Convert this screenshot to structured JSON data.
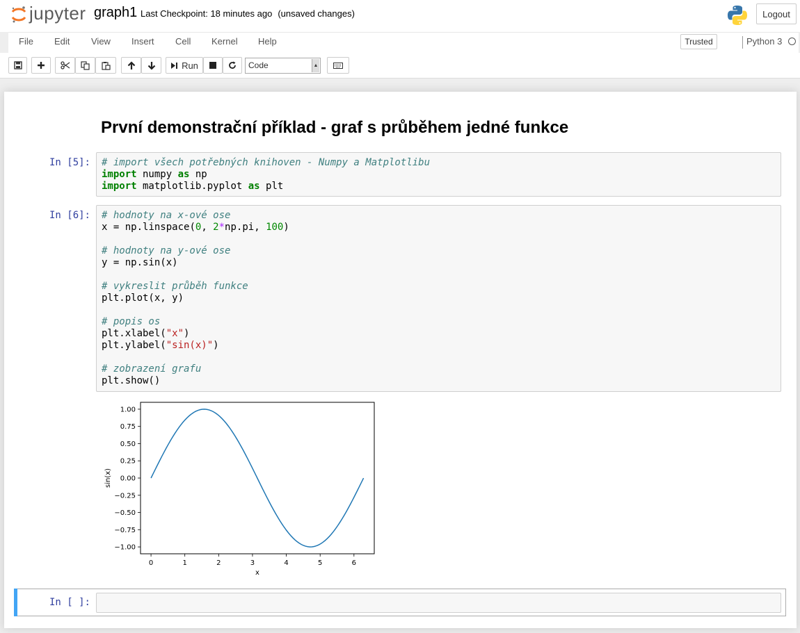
{
  "header": {
    "logo_text": "jupyter",
    "notebook_name": "graph1",
    "checkpoint": "Last Checkpoint: 18 minutes ago",
    "unsaved": "(unsaved changes)",
    "logout_label": "Logout"
  },
  "menubar": {
    "items": [
      "File",
      "Edit",
      "View",
      "Insert",
      "Cell",
      "Kernel",
      "Help"
    ],
    "trusted_label": "Trusted",
    "kernel_name": "Python 3"
  },
  "toolbar": {
    "run_label": "Run",
    "cell_type": "Code",
    "icons": [
      "save-icon",
      "plus-icon",
      "scissors-icon",
      "copy-icon",
      "paste-icon",
      "arrow-up-icon",
      "arrow-down-icon",
      "run-icon",
      "stop-icon",
      "restart-icon",
      "keyboard-icon"
    ]
  },
  "cells": {
    "heading": "První demonstrační příklad - graf s průběhem jedné funkce",
    "cell5": {
      "prompt": "In [5]:",
      "lines": [
        "# import všech potřebných knihoven - Numpy a Matplotlibu",
        "import numpy as np",
        "import matplotlib.pyplot as plt"
      ]
    },
    "cell6": {
      "prompt": "In [6]:",
      "lines": [
        "# hodnoty na x-ové ose",
        "x = np.linspace(0, 2*np.pi, 100)",
        "",
        "# hodnoty na y-ové ose",
        "y = np.sin(x)",
        "",
        "# vykreslit průběh funkce",
        "plt.plot(x, y)",
        "",
        "# popis os",
        "plt.xlabel(\"x\")",
        "plt.ylabel(\"sin(x)\")",
        "",
        "# zobrazení grafu",
        "plt.show()"
      ]
    },
    "empty_prompt": "In [ ]:"
  },
  "chart_data": {
    "type": "line",
    "xlabel": "x",
    "ylabel": "sin(x)",
    "xlim": [
      -0.31,
      6.6
    ],
    "ylim": [
      -1.1,
      1.1
    ],
    "xticks": [
      "0",
      "1",
      "2",
      "3",
      "4",
      "5",
      "6"
    ],
    "yticks": [
      "1.00",
      "0.75",
      "0.50",
      "0.25",
      "0.00",
      "−0.25",
      "−0.50",
      "−0.75",
      "−1.00"
    ],
    "series": [
      {
        "function": "sin(x)",
        "x_range": [
          0,
          6.283
        ],
        "points": 100,
        "color": "#1f77b4"
      }
    ],
    "grid": false
  }
}
